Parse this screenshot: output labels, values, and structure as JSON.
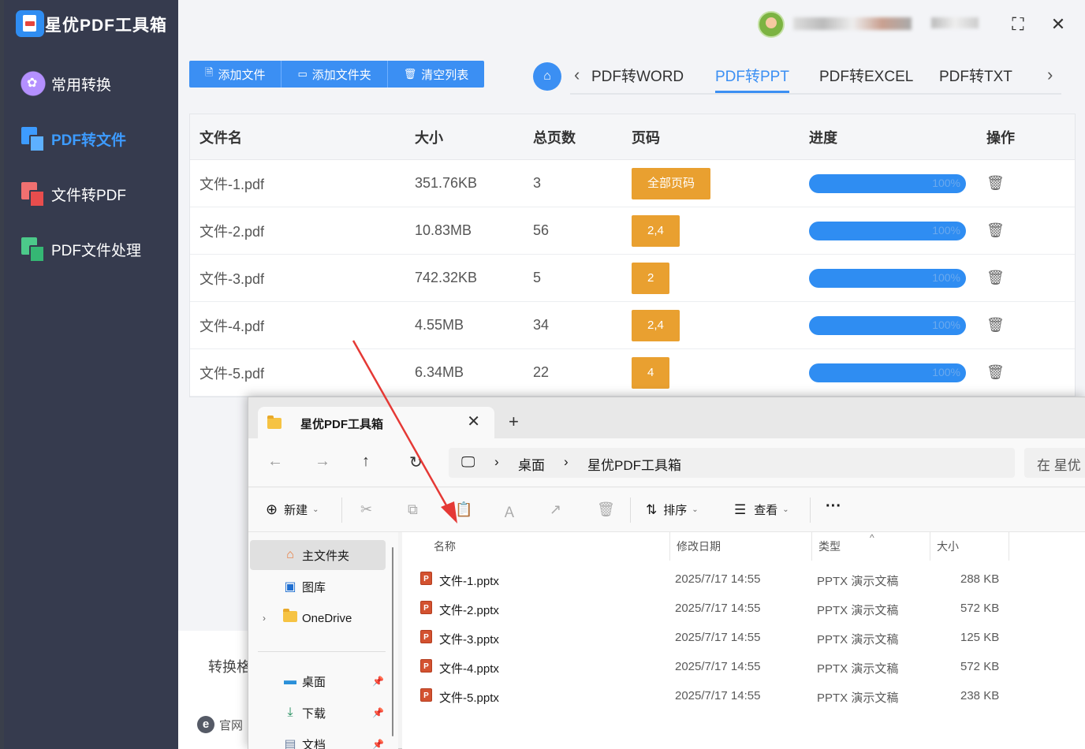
{
  "app": {
    "title": "星优PDF工具箱"
  },
  "sidebar": {
    "items": [
      {
        "label": "常用转换",
        "active": false
      },
      {
        "label": "PDF转文件",
        "active": true
      },
      {
        "label": "文件转PDF",
        "active": false
      },
      {
        "label": "PDF文件处理",
        "active": false
      }
    ]
  },
  "toolbar": {
    "add_file": "添加文件",
    "add_folder": "添加文件夹",
    "clear_list": "清空列表"
  },
  "tabs": [
    {
      "label": "PDF转WORD",
      "active": false
    },
    {
      "label": "PDF转PPT",
      "active": true
    },
    {
      "label": "PDF转EXCEL",
      "active": false
    },
    {
      "label": "PDF转TXT",
      "active": false
    }
  ],
  "table": {
    "headers": [
      "文件名",
      "大小",
      "总页数",
      "页码",
      "进度",
      "操作"
    ],
    "rows": [
      {
        "name": "文件-1.pdf",
        "size": "351.76KB",
        "pages": "3",
        "page_range": "全部页码",
        "progress": "100%"
      },
      {
        "name": "文件-2.pdf",
        "size": "10.83MB",
        "pages": "56",
        "page_range": "2,4",
        "progress": "100%"
      },
      {
        "name": "文件-3.pdf",
        "size": "742.32KB",
        "pages": "5",
        "page_range": "2",
        "progress": "100%"
      },
      {
        "name": "文件-4.pdf",
        "size": "4.55MB",
        "pages": "34",
        "page_range": "2,4",
        "progress": "100%"
      },
      {
        "name": "文件-5.pdf",
        "size": "6.34MB",
        "pages": "22",
        "page_range": "4",
        "progress": "100%"
      }
    ]
  },
  "bottom": {
    "format_label": "转换格",
    "website": "官网"
  },
  "colors": {
    "accent": "#3b8ff3",
    "page_button": "#e9a030",
    "sidebar_bg": "#363b4e",
    "arrow": "#e53935"
  },
  "explorer": {
    "tab_title": "星优PDF工具箱",
    "breadcrumb": [
      "桌面",
      "星优PDF工具箱"
    ],
    "search_placeholder": "在 星优",
    "commands": {
      "new": "新建",
      "sort": "排序",
      "view": "查看"
    },
    "nav": [
      {
        "label": "主文件夹",
        "icon": "home-icon"
      },
      {
        "label": "图库",
        "icon": "gallery-icon"
      },
      {
        "label": "OneDrive",
        "icon": "folder-icon"
      },
      {
        "label": "桌面",
        "icon": "desktop-icon"
      },
      {
        "label": "下载",
        "icon": "download-icon"
      },
      {
        "label": "文档",
        "icon": "document-icon"
      }
    ],
    "columns": [
      "名称",
      "修改日期",
      "类型",
      "大小"
    ],
    "files": [
      {
        "name": "文件-1.pptx",
        "date": "2025/7/17 14:55",
        "type": "PPTX 演示文稿",
        "size": "288 KB"
      },
      {
        "name": "文件-2.pptx",
        "date": "2025/7/17 14:55",
        "type": "PPTX 演示文稿",
        "size": "572 KB"
      },
      {
        "name": "文件-3.pptx",
        "date": "2025/7/17 14:55",
        "type": "PPTX 演示文稿",
        "size": "125 KB"
      },
      {
        "name": "文件-4.pptx",
        "date": "2025/7/17 14:55",
        "type": "PPTX 演示文稿",
        "size": "572 KB"
      },
      {
        "name": "文件-5.pptx",
        "date": "2025/7/17 14:55",
        "type": "PPTX 演示文稿",
        "size": "238 KB"
      }
    ]
  }
}
